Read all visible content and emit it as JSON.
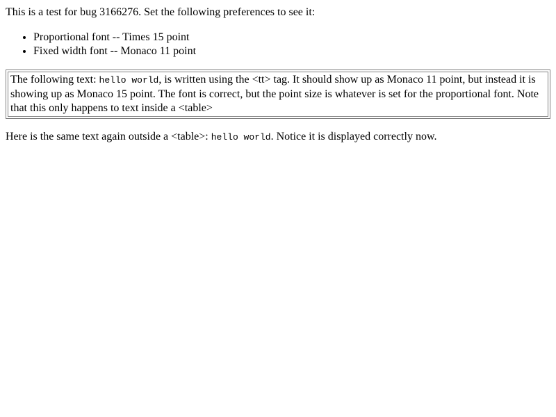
{
  "intro": {
    "text": "This is a test for bug 3166276. Set the following preferences to see it:"
  },
  "prefs": [
    {
      "label": "Proportional font -- Times 15 point"
    },
    {
      "label": "Fixed width font -- Monaco 11 point"
    }
  ],
  "table_cell": {
    "before": "The following text: ",
    "code": "hello world",
    "after": ", is written using the <tt> tag. It should show up as Monaco 11 point, but instead it is showing up as Monaco 15 point. The font is correct, but the point size is whatever is set for the proportional font. Note that this only happens to text inside a <table>"
  },
  "outside": {
    "before": "Here is the same text again outside a <table>: ",
    "code": "hello world",
    "after": ". Notice it is displayed correctly now."
  }
}
